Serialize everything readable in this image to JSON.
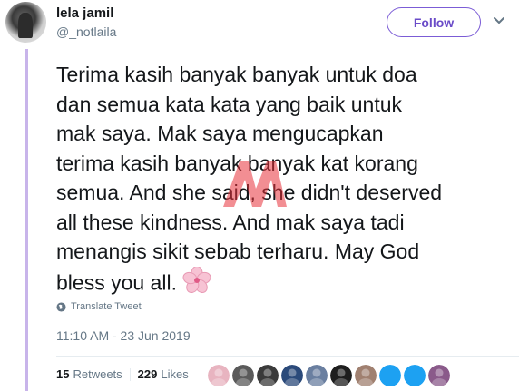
{
  "user": {
    "name": "lela jamil",
    "handle": "@_notlaila"
  },
  "follow_label": "Follow",
  "tweet": {
    "text": "Terima kasih banyak banyak untuk doa\ndan semua kata kata yang baik untuk\nmak saya. Mak saya mengucapkan\nterima kasih banyak banyak kat korang\nsemua. And she said, she didn't deserved\nall these kindness. And mak saya tadi\nmenangis sikit sebab terharu. May God\nbless you all.",
    "emoji": "cherry-blossom-icon",
    "translate_label": "Translate Tweet",
    "timestamp": "11:10 AM - 23 Jun 2019"
  },
  "stats": {
    "retweets_count": "15",
    "retweets_label": "Retweets",
    "likes_count": "229",
    "likes_label": "Likes"
  },
  "likers": [
    {
      "color": "#e8b4c0",
      "icon": "liker-avatar-1"
    },
    {
      "color": "#5a5a5a",
      "icon": "liker-avatar-2"
    },
    {
      "color": "#3b3b3b",
      "icon": "liker-avatar-3"
    },
    {
      "color": "#2b4a7a",
      "icon": "liker-avatar-4"
    },
    {
      "color": "#6a7fa0",
      "icon": "liker-avatar-5"
    },
    {
      "color": "#1e1e1e",
      "icon": "liker-avatar-6"
    },
    {
      "color": "#a08070",
      "icon": "liker-avatar-7"
    },
    {
      "color": "#1da1f2",
      "icon": "liker-avatar-8"
    },
    {
      "color": "#1da1f2",
      "icon": "liker-avatar-9"
    },
    {
      "color": "#8a5a8a",
      "icon": "liker-avatar-10"
    }
  ],
  "colors": {
    "accent": "#7b5cd6",
    "thread_line": "#c8b4ea",
    "secondary_text": "#657786"
  }
}
